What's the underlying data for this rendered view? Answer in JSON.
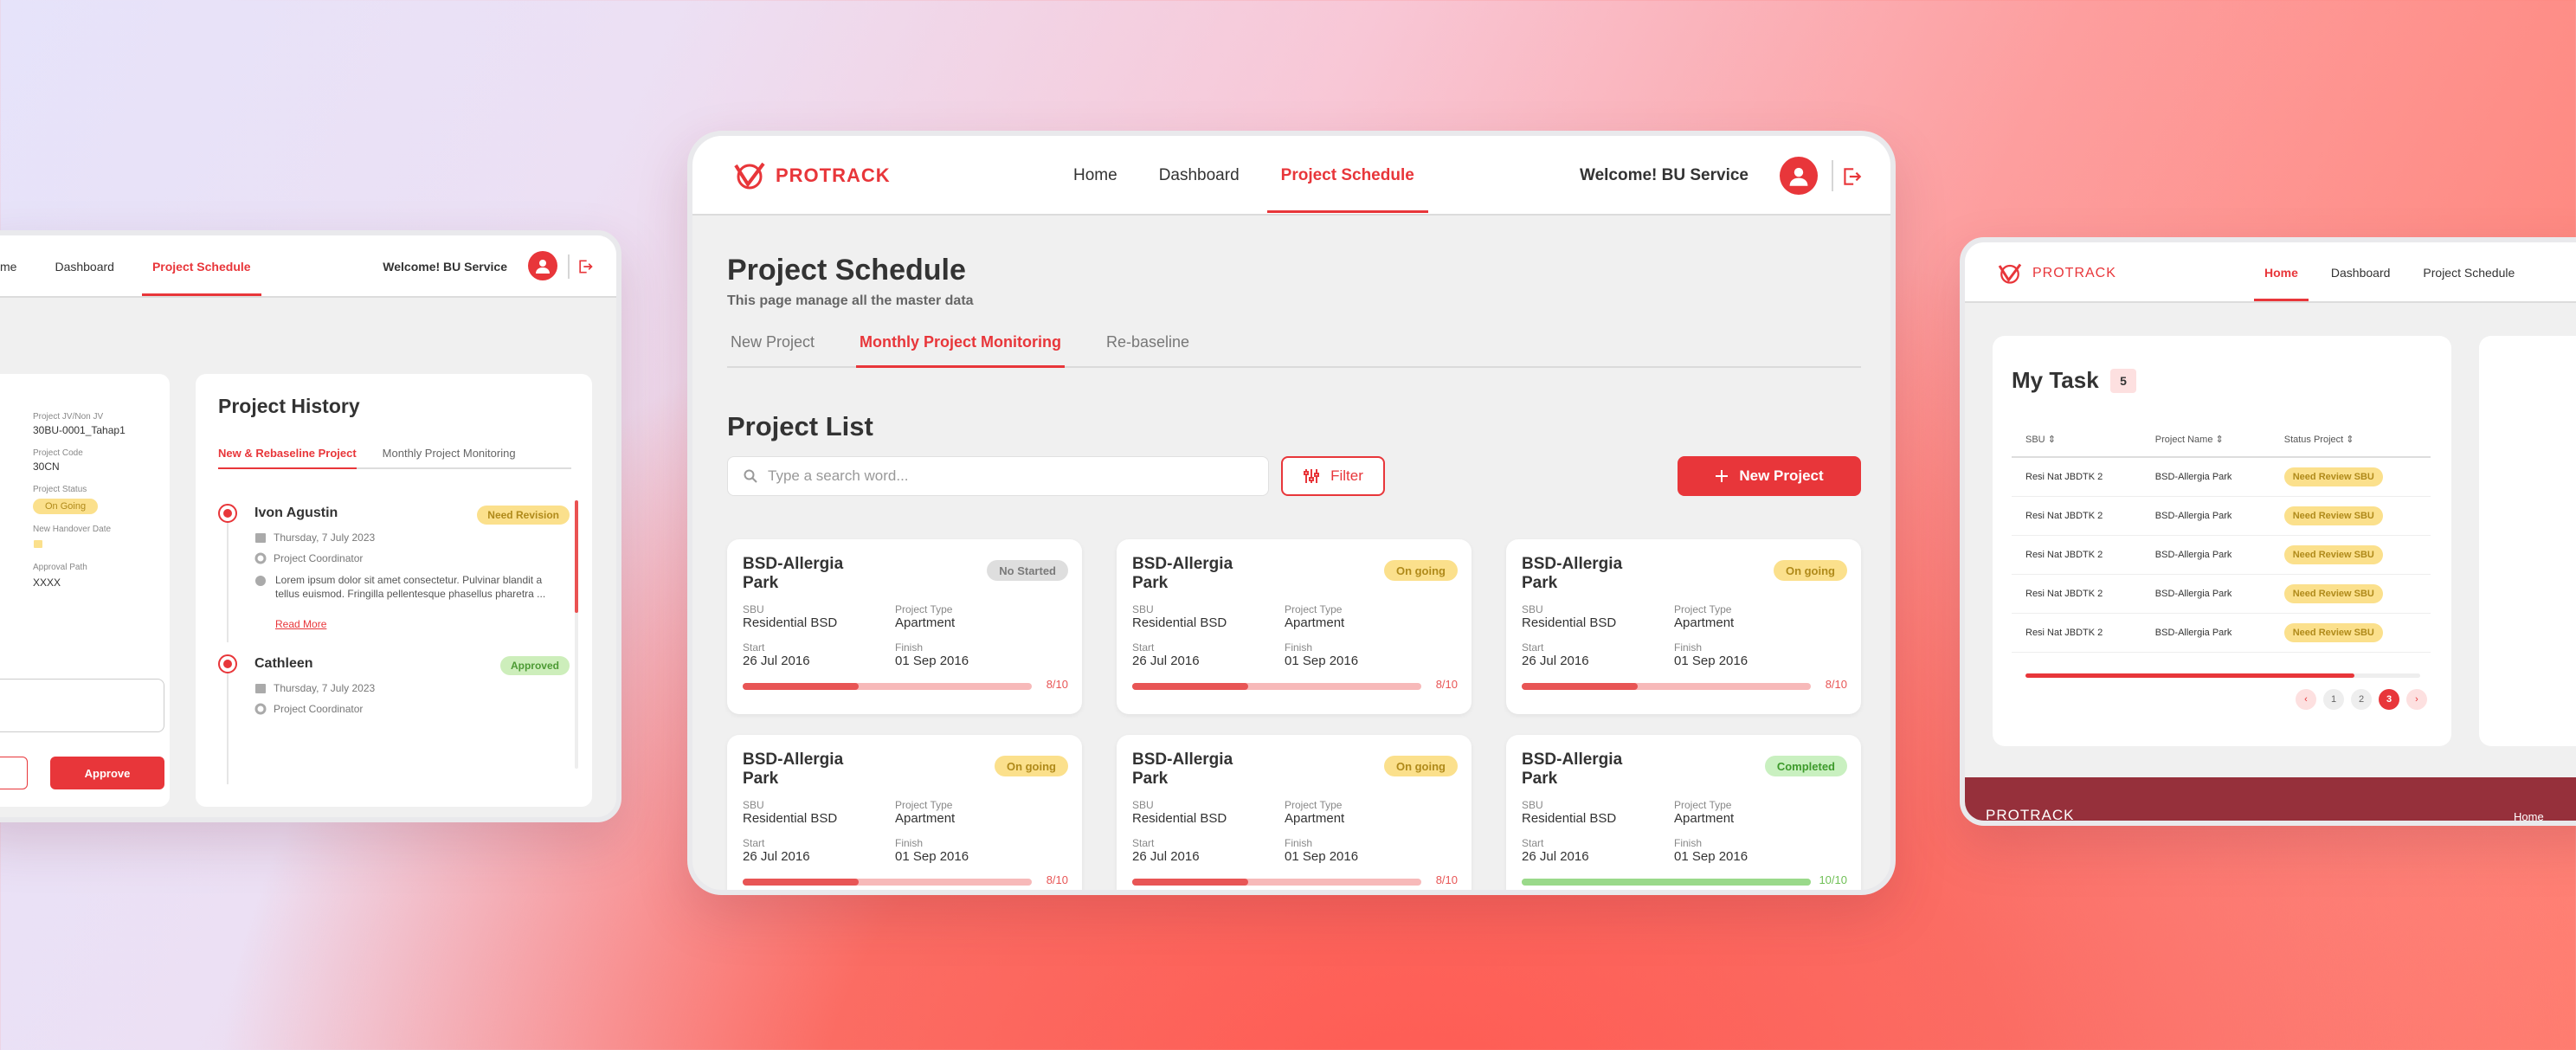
{
  "brand": {
    "name": "PROTRACK",
    "accent": "#e8363a"
  },
  "main": {
    "nav": [
      "Home",
      "Dashboard",
      "Project Schedule"
    ],
    "active_nav": "Project Schedule",
    "welcome": "Welcome! BU Service",
    "page_title": "Project Schedule",
    "page_subtitle": "This page manage all the master data",
    "tabs": [
      "New Project",
      "Monthly Project Monitoring",
      "Re-baseline"
    ],
    "active_tab": "Monthly Project Monitoring",
    "list_title": "Project List",
    "search_placeholder": "Type a search word...",
    "filter_label": "Filter",
    "new_project_label": "New Project",
    "labels": {
      "sbu": "SBU",
      "type": "Project Type",
      "start": "Start",
      "finish": "Finish"
    },
    "cards": [
      {
        "title": "BSD-Allergia Park",
        "status": "No Started",
        "status_color": "grey",
        "sbu": "Residential BSD",
        "type": "Apartment",
        "start": "26 Jul 2016",
        "finish": "01 Sep 2016",
        "progress": "8/10",
        "fraction": 0.4
      },
      {
        "title": "BSD-Allergia Park",
        "status": "On going",
        "status_color": "yellow",
        "sbu": "Residential BSD",
        "type": "Apartment",
        "start": "26 Jul 2016",
        "finish": "01 Sep 2016",
        "progress": "8/10",
        "fraction": 0.4
      },
      {
        "title": "BSD-Allergia Park",
        "status": "On going",
        "status_color": "yellow",
        "sbu": "Residential BSD",
        "type": "Apartment",
        "start": "26 Jul 2016",
        "finish": "01 Sep 2016",
        "progress": "8/10",
        "fraction": 0.4
      },
      {
        "title": "BSD-Allergia Park",
        "status": "On going",
        "status_color": "yellow",
        "sbu": "Residential BSD",
        "type": "Apartment",
        "start": "26 Jul 2016",
        "finish": "01 Sep 2016",
        "progress": "8/10",
        "fraction": 0.4
      },
      {
        "title": "BSD-Allergia Park",
        "status": "On going",
        "status_color": "yellow",
        "sbu": "Residential BSD",
        "type": "Apartment",
        "start": "26 Jul 2016",
        "finish": "01 Sep 2016",
        "progress": "8/10",
        "fraction": 0.4
      },
      {
        "title": "BSD-Allergia Park",
        "status": "Completed",
        "status_color": "green",
        "sbu": "Residential BSD",
        "type": "Apartment",
        "start": "26 Jul 2016",
        "finish": "01 Sep 2016",
        "progress": "10/10",
        "fraction": 1.0
      }
    ]
  },
  "left": {
    "nav": [
      "me",
      "Dashboard",
      "Project Schedule"
    ],
    "welcome": "Welcome! BU Service",
    "details": [
      {
        "label": "Project JV/Non JV",
        "value": "30BU-0001_Tahap1"
      },
      {
        "label": "Project Code",
        "value": "30CN"
      },
      {
        "label": "Project Status",
        "value": "On Going"
      },
      {
        "label": "New Handover Date",
        "value": ""
      },
      {
        "label": "Approval Path",
        "value": "XXXX"
      }
    ],
    "approve_label": "Approve",
    "history_title": "Project History",
    "history_tabs": [
      "New & Rebaseline Project",
      "Monthly Project Monitoring"
    ],
    "history": [
      {
        "name": "Ivon Agustin",
        "status": "Need Revision",
        "date": "Thursday, 7 July 2023",
        "role": "Project Coordinator",
        "comment": "Lorem ipsum dolor sit amet consectetur. Pulvinar blandit a tellus euismod. Fringilla pellentesque phasellus pharetra ...",
        "more": "Read More"
      },
      {
        "name": "Cathleen",
        "status": "Approved",
        "date": "Thursday, 7 July 2023",
        "role": "Project Coordinator"
      }
    ]
  },
  "right": {
    "nav": [
      "Home",
      "Dashboard",
      "Project Schedule"
    ],
    "task_title": "My Task",
    "task_count": "5",
    "columns": [
      "SBU",
      "Project Name",
      "Status Project"
    ],
    "rows": [
      [
        "Resi Nat JBDTK 2",
        "BSD-Allergia Park",
        "Need Review SBU"
      ],
      [
        "Resi Nat JBDTK 2",
        "BSD-Allergia Park",
        "Need Review SBU"
      ],
      [
        "Resi Nat JBDTK 2",
        "BSD-Allergia Park",
        "Need Review SBU"
      ],
      [
        "Resi Nat JBDTK 2",
        "BSD-Allergia Park",
        "Need Review SBU"
      ],
      [
        "Resi Nat JBDTK 2",
        "BSD-Allergia Park",
        "Need Review SBU"
      ]
    ],
    "pages": [
      "1",
      "2",
      "3"
    ],
    "current_page": "3",
    "footer_brand": "PROTRACK",
    "footer_home": "Home"
  }
}
